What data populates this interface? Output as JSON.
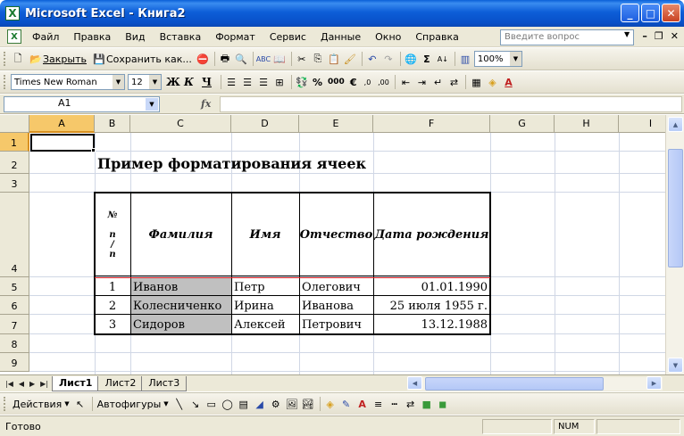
{
  "window": {
    "title": "Microsoft Excel - Книга2",
    "app_icon": "X"
  },
  "menu": {
    "items": [
      "Файл",
      "Правка",
      "Вид",
      "Вставка",
      "Формат",
      "Сервис",
      "Данные",
      "Окно",
      "Справка"
    ],
    "help_placeholder": "Введите вопрос"
  },
  "toolbar": {
    "close_label": "Закрыть",
    "save_as_label": "Сохранить как...",
    "zoom": "100%"
  },
  "formatting": {
    "font": "Times New Roman",
    "size": "12",
    "bold": "Ж",
    "italic": "К",
    "underline": "Ч",
    "percent": "%",
    "thousands": "000",
    "euro": "€"
  },
  "formula_bar": {
    "cell_ref": "A1",
    "fx": "fx",
    "formula": ""
  },
  "columns": [
    "A",
    "B",
    "C",
    "D",
    "E",
    "F",
    "G",
    "H",
    "I"
  ],
  "rows": [
    "1",
    "2",
    "3",
    "4",
    "5",
    "6",
    "7",
    "8",
    "9"
  ],
  "sheet": {
    "title": "Пример форматирования ячеек",
    "table_headers": {
      "num": "№\n\nп\n/\nп",
      "surname": "Фамилия",
      "name": "Имя",
      "patronymic": "Отчество",
      "birthdate": "Дата рождения"
    },
    "table_rows": [
      {
        "num": "1",
        "surname": "Иванов",
        "name": "Петр",
        "patronymic": "Олегович",
        "birthdate": "01.01.1990"
      },
      {
        "num": "2",
        "surname": "Колесниченко",
        "name": "Ирина",
        "patronymic": "Иванова",
        "birthdate": "25 июля 1955 г."
      },
      {
        "num": "3",
        "surname": "Сидоров",
        "name": "Алексей",
        "patronymic": "Петрович",
        "birthdate": "13.12.1988"
      }
    ]
  },
  "tabs": [
    "Лист1",
    "Лист2",
    "Лист3"
  ],
  "drawing": {
    "actions_label": "Действия",
    "autoshapes_label": "Автофигуры"
  },
  "status": {
    "ready": "Готово",
    "num": "NUM"
  },
  "colors": {
    "title_bar": "#0a5fd8",
    "selection_header": "#f6c86a",
    "shaded_cell": "#c0c0c0",
    "header_underline": "#e02020"
  }
}
